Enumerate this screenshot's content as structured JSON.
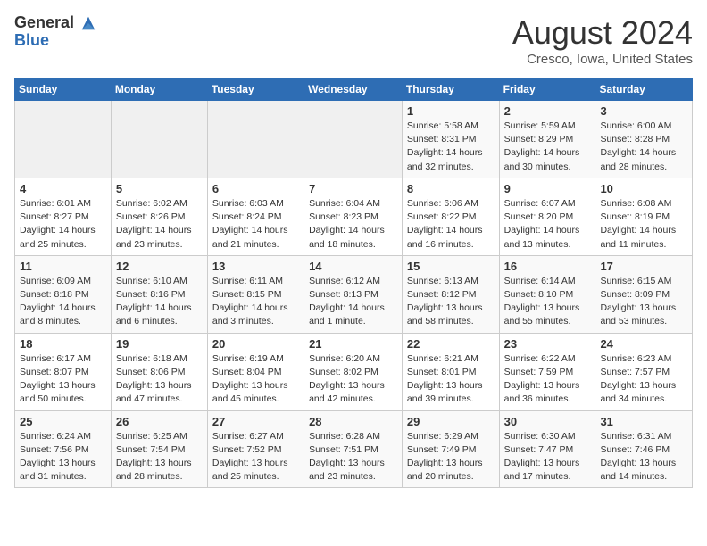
{
  "header": {
    "logo_line1": "General",
    "logo_line2": "Blue",
    "month_title": "August 2024",
    "location": "Cresco, Iowa, United States"
  },
  "days_of_week": [
    "Sunday",
    "Monday",
    "Tuesday",
    "Wednesday",
    "Thursday",
    "Friday",
    "Saturday"
  ],
  "weeks": [
    [
      {
        "day": "",
        "info": ""
      },
      {
        "day": "",
        "info": ""
      },
      {
        "day": "",
        "info": ""
      },
      {
        "day": "",
        "info": ""
      },
      {
        "day": "1",
        "info": "Sunrise: 5:58 AM\nSunset: 8:31 PM\nDaylight: 14 hours\nand 32 minutes."
      },
      {
        "day": "2",
        "info": "Sunrise: 5:59 AM\nSunset: 8:29 PM\nDaylight: 14 hours\nand 30 minutes."
      },
      {
        "day": "3",
        "info": "Sunrise: 6:00 AM\nSunset: 8:28 PM\nDaylight: 14 hours\nand 28 minutes."
      }
    ],
    [
      {
        "day": "4",
        "info": "Sunrise: 6:01 AM\nSunset: 8:27 PM\nDaylight: 14 hours\nand 25 minutes."
      },
      {
        "day": "5",
        "info": "Sunrise: 6:02 AM\nSunset: 8:26 PM\nDaylight: 14 hours\nand 23 minutes."
      },
      {
        "day": "6",
        "info": "Sunrise: 6:03 AM\nSunset: 8:24 PM\nDaylight: 14 hours\nand 21 minutes."
      },
      {
        "day": "7",
        "info": "Sunrise: 6:04 AM\nSunset: 8:23 PM\nDaylight: 14 hours\nand 18 minutes."
      },
      {
        "day": "8",
        "info": "Sunrise: 6:06 AM\nSunset: 8:22 PM\nDaylight: 14 hours\nand 16 minutes."
      },
      {
        "day": "9",
        "info": "Sunrise: 6:07 AM\nSunset: 8:20 PM\nDaylight: 14 hours\nand 13 minutes."
      },
      {
        "day": "10",
        "info": "Sunrise: 6:08 AM\nSunset: 8:19 PM\nDaylight: 14 hours\nand 11 minutes."
      }
    ],
    [
      {
        "day": "11",
        "info": "Sunrise: 6:09 AM\nSunset: 8:18 PM\nDaylight: 14 hours\nand 8 minutes."
      },
      {
        "day": "12",
        "info": "Sunrise: 6:10 AM\nSunset: 8:16 PM\nDaylight: 14 hours\nand 6 minutes."
      },
      {
        "day": "13",
        "info": "Sunrise: 6:11 AM\nSunset: 8:15 PM\nDaylight: 14 hours\nand 3 minutes."
      },
      {
        "day": "14",
        "info": "Sunrise: 6:12 AM\nSunset: 8:13 PM\nDaylight: 14 hours\nand 1 minute."
      },
      {
        "day": "15",
        "info": "Sunrise: 6:13 AM\nSunset: 8:12 PM\nDaylight: 13 hours\nand 58 minutes."
      },
      {
        "day": "16",
        "info": "Sunrise: 6:14 AM\nSunset: 8:10 PM\nDaylight: 13 hours\nand 55 minutes."
      },
      {
        "day": "17",
        "info": "Sunrise: 6:15 AM\nSunset: 8:09 PM\nDaylight: 13 hours\nand 53 minutes."
      }
    ],
    [
      {
        "day": "18",
        "info": "Sunrise: 6:17 AM\nSunset: 8:07 PM\nDaylight: 13 hours\nand 50 minutes."
      },
      {
        "day": "19",
        "info": "Sunrise: 6:18 AM\nSunset: 8:06 PM\nDaylight: 13 hours\nand 47 minutes."
      },
      {
        "day": "20",
        "info": "Sunrise: 6:19 AM\nSunset: 8:04 PM\nDaylight: 13 hours\nand 45 minutes."
      },
      {
        "day": "21",
        "info": "Sunrise: 6:20 AM\nSunset: 8:02 PM\nDaylight: 13 hours\nand 42 minutes."
      },
      {
        "day": "22",
        "info": "Sunrise: 6:21 AM\nSunset: 8:01 PM\nDaylight: 13 hours\nand 39 minutes."
      },
      {
        "day": "23",
        "info": "Sunrise: 6:22 AM\nSunset: 7:59 PM\nDaylight: 13 hours\nand 36 minutes."
      },
      {
        "day": "24",
        "info": "Sunrise: 6:23 AM\nSunset: 7:57 PM\nDaylight: 13 hours\nand 34 minutes."
      }
    ],
    [
      {
        "day": "25",
        "info": "Sunrise: 6:24 AM\nSunset: 7:56 PM\nDaylight: 13 hours\nand 31 minutes."
      },
      {
        "day": "26",
        "info": "Sunrise: 6:25 AM\nSunset: 7:54 PM\nDaylight: 13 hours\nand 28 minutes."
      },
      {
        "day": "27",
        "info": "Sunrise: 6:27 AM\nSunset: 7:52 PM\nDaylight: 13 hours\nand 25 minutes."
      },
      {
        "day": "28",
        "info": "Sunrise: 6:28 AM\nSunset: 7:51 PM\nDaylight: 13 hours\nand 23 minutes."
      },
      {
        "day": "29",
        "info": "Sunrise: 6:29 AM\nSunset: 7:49 PM\nDaylight: 13 hours\nand 20 minutes."
      },
      {
        "day": "30",
        "info": "Sunrise: 6:30 AM\nSunset: 7:47 PM\nDaylight: 13 hours\nand 17 minutes."
      },
      {
        "day": "31",
        "info": "Sunrise: 6:31 AM\nSunset: 7:46 PM\nDaylight: 13 hours\nand 14 minutes."
      }
    ]
  ]
}
